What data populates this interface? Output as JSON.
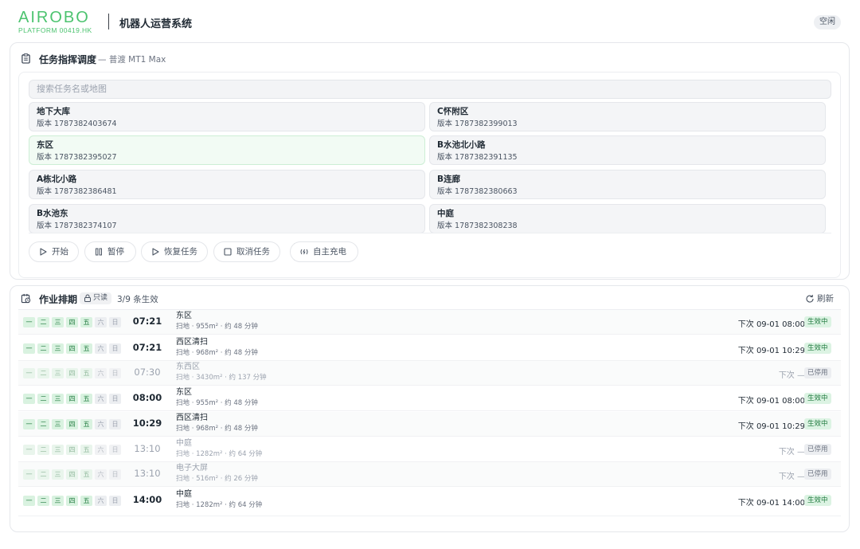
{
  "header": {
    "logo_main": "AIROBO",
    "logo_sub": "PLATFORM 00419.HK",
    "system_title": "机器人运营系统",
    "status": "空闲"
  },
  "dispatch": {
    "title": "任务指挥调度",
    "robot": "— 普渡 MT1 Max",
    "search_placeholder": "搜索任务名或地图",
    "maps": [
      {
        "name": "地下大库",
        "version": "版本 1787382403674",
        "selected": false
      },
      {
        "name": "C怀附区",
        "version": "版本 1787382399013",
        "selected": false
      },
      {
        "name": "东区",
        "version": "版本 1787382395027",
        "selected": true
      },
      {
        "name": "B水池北小路",
        "version": "版本 1787382391135",
        "selected": false
      },
      {
        "name": "A栋北小路",
        "version": "版本 1787382386481",
        "selected": false
      },
      {
        "name": "B连廊",
        "version": "版本 1787382380663",
        "selected": false
      },
      {
        "name": "B水池东",
        "version": "版本 1787382374107",
        "selected": false
      },
      {
        "name": "中庭",
        "version": "版本 1787382308238",
        "selected": false
      }
    ],
    "buttons": {
      "start": "开始",
      "pause": "暂停",
      "resume": "恢复任务",
      "cancel": "取消任务",
      "charge": "自主充电"
    }
  },
  "schedule": {
    "title": "作业排期",
    "readonly": "只读",
    "count": "3/9 条生效",
    "refresh": "刷新",
    "weekdays": [
      "一",
      "二",
      "三",
      "四",
      "五",
      "六",
      "日"
    ],
    "rows": [
      {
        "days": [
          1,
          1,
          1,
          1,
          1,
          0,
          0
        ],
        "time": "07:21",
        "name": "东区",
        "meta": "扫地 · 955m² · 约 48 分钟",
        "next": "下次 09-01 08:00",
        "status": "生效中",
        "active": true
      },
      {
        "days": [
          1,
          1,
          1,
          1,
          1,
          0,
          0
        ],
        "time": "07:21",
        "name": "西区清扫",
        "meta": "扫地 · 968m² · 约 48 分钟",
        "next": "下次 09-01 10:29",
        "status": "生效中",
        "active": true
      },
      {
        "days": [
          1,
          1,
          1,
          1,
          1,
          0,
          0
        ],
        "time": "07:30",
        "name": "东西区",
        "meta": "扫地 · 3430m² · 约 137 分钟",
        "next": "下次 —",
        "status": "已停用",
        "active": false
      },
      {
        "days": [
          1,
          1,
          1,
          1,
          1,
          0,
          0
        ],
        "time": "08:00",
        "name": "东区",
        "meta": "扫地 · 955m² · 约 48 分钟",
        "next": "下次 09-01 08:00",
        "status": "生效中",
        "active": true
      },
      {
        "days": [
          1,
          1,
          1,
          1,
          1,
          0,
          0
        ],
        "time": "10:29",
        "name": "西区清扫",
        "meta": "扫地 · 968m² · 约 48 分钟",
        "next": "下次 09-01 10:29",
        "status": "生效中",
        "active": true
      },
      {
        "days": [
          1,
          1,
          1,
          1,
          1,
          0,
          0
        ],
        "time": "13:10",
        "name": "中庭",
        "meta": "扫地 · 1282m² · 约 64 分钟",
        "next": "下次 —",
        "status": "已停用",
        "active": false
      },
      {
        "days": [
          1,
          1,
          1,
          1,
          1,
          0,
          0
        ],
        "time": "13:10",
        "name": "电子大屏",
        "meta": "扫地 · 516m² · 约 26 分钟",
        "next": "下次 —",
        "status": "已停用",
        "active": false
      },
      {
        "days": [
          1,
          1,
          1,
          1,
          1,
          0,
          0
        ],
        "time": "14:00",
        "name": "中庭",
        "meta": "扫地 · 1282m² · 约 64 分钟",
        "next": "下次 09-01 14:00",
        "status": "生效中",
        "active": true
      }
    ]
  }
}
